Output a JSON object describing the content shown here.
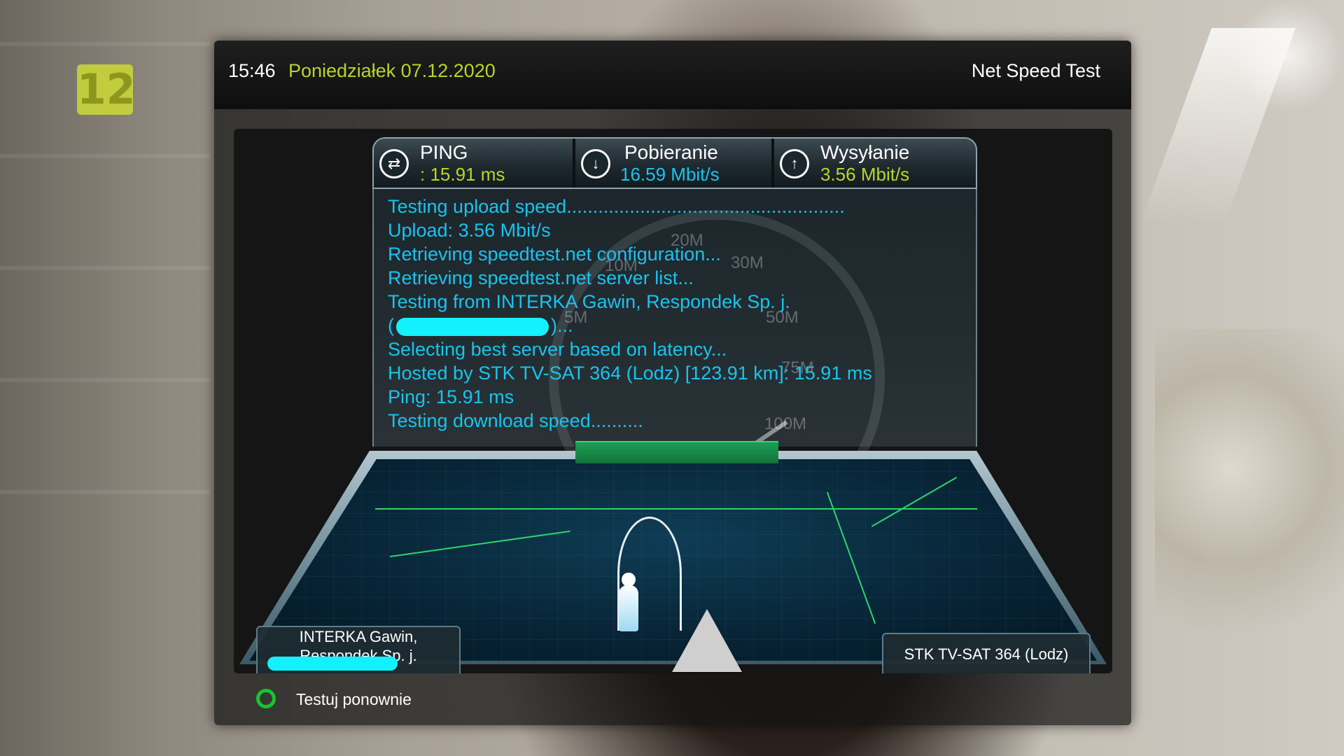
{
  "channel": {
    "logo_text": "12"
  },
  "header": {
    "time": "15:46",
    "date": "Poniedziałek 07.12.2020",
    "title": "Net Speed Test"
  },
  "stats": {
    "ping": {
      "label": "PING",
      "value": ": 15.91 ms"
    },
    "download": {
      "label": "Pobieranie",
      "value": "16.59 Mbit/s"
    },
    "upload": {
      "label": "Wysyłanie",
      "value": "3.56 Mbit/s"
    }
  },
  "gauge": {
    "ticks": [
      "10M",
      "20M",
      "30M",
      "5M",
      "50M",
      "75M",
      "100M"
    ]
  },
  "log": [
    "Testing upload speed.....................................................",
    "Upload: 3.56 Mbit/s",
    "Retrieving speedtest.net configuration...",
    "Retrieving speedtest.net server list...",
    "Testing from INTERKA Gawin, Respondek Sp. j.",
    "(",
    ")...",
    "Selecting best server based on latency...",
    "Hosted by STK TV-SAT 364 (Lodz) [123.91 km]: 15.91 ms",
    "Ping: 15.91 ms",
    "Testing download speed.........."
  ],
  "locations": {
    "client_line1": "INTERKA Gawin,",
    "client_line2": "Respondek Sp. j.",
    "server": "STK TV-SAT 364 (Lodz)"
  },
  "footer": {
    "retest_label": "Testuj ponownie"
  },
  "colors": {
    "accent_green": "#b6d62a",
    "log_text": "#19c3ef",
    "redact": "#13f1ff",
    "button_green": "#15c62e"
  }
}
